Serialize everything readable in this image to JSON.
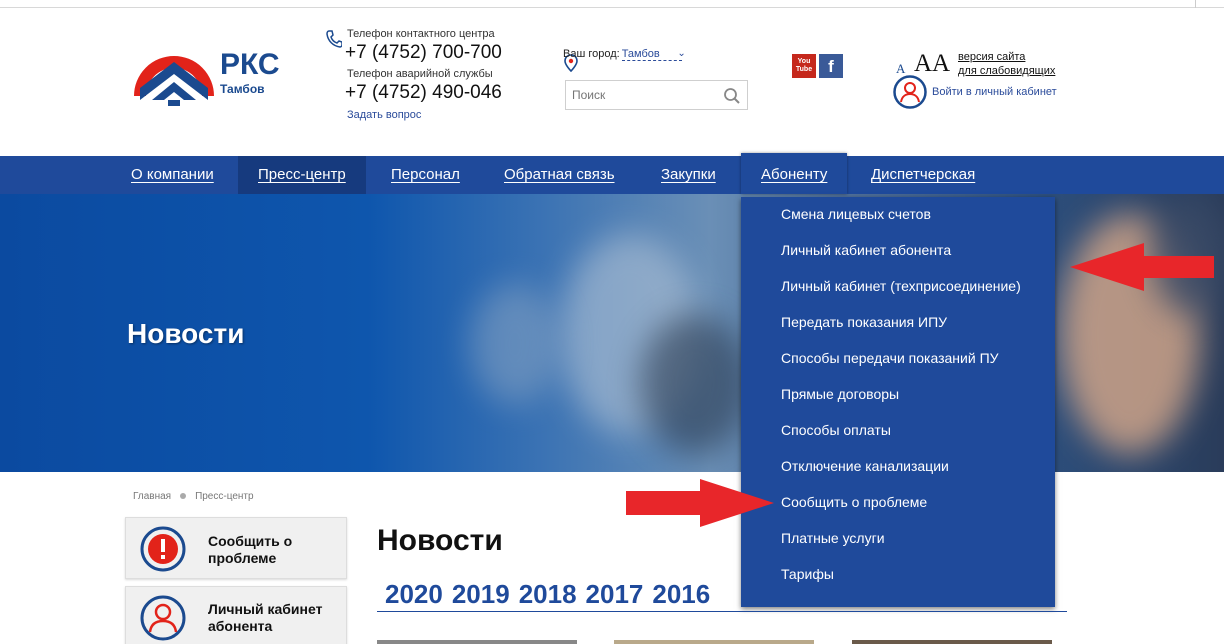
{
  "header": {
    "logo_title": "РКС",
    "logo_city": "Тамбов",
    "contact_label": "Телефон контактного центра",
    "contact_phone": "+7 (4752) 700-700",
    "emergency_label": "Телефон аварийной службы",
    "emergency_phone": "+7 (4752) 490-046",
    "ask_link": "Задать вопрос",
    "city_label": "Ваш город:",
    "city_value": "Тамбов",
    "search_placeholder": "Поиск",
    "youtube_label": "You Tube",
    "facebook_label": "f",
    "font_small": "A",
    "font_big": "AA",
    "vision_line1": "версия сайта",
    "vision_line2": "для слабовидящих",
    "login_link": "Войти в личный кабинет"
  },
  "nav": {
    "items": [
      "О компании",
      "Пресс-центр",
      "Персонал",
      "Обратная связь",
      "Закупки",
      "Абоненту",
      "Диспетчерская"
    ],
    "active": "Пресс-центр",
    "open": "Абоненту"
  },
  "hero": {
    "title": "Новости"
  },
  "dropdown": {
    "items": [
      "Смена лицевых счетов",
      "Личный кабинет абонента",
      "Личный кабинет (техприсоединение)",
      "Передать показания ИПУ",
      "Способы передачи показаний ПУ",
      "Прямые договоры",
      "Способы оплаты",
      "Отключение канализации",
      "Сообщить о проблеме",
      "Платные услуги",
      "Тарифы"
    ]
  },
  "breadcrumb": {
    "home": "Главная",
    "current": "Пресс-центр"
  },
  "sidebar": {
    "cards": [
      {
        "line1": "Сообщить о",
        "line2": "проблеме",
        "icon": "alert-icon"
      },
      {
        "line1": "Личный кабинет",
        "line2": "абонента",
        "icon": "user-icon"
      }
    ]
  },
  "main": {
    "title": "Новости",
    "years": [
      "2020",
      "2019",
      "2018",
      "2017",
      "2016"
    ]
  },
  "colors": {
    "brand_blue": "#1f4a9b",
    "logo_red": "#e2231a",
    "arrow_red": "#e8262a"
  }
}
